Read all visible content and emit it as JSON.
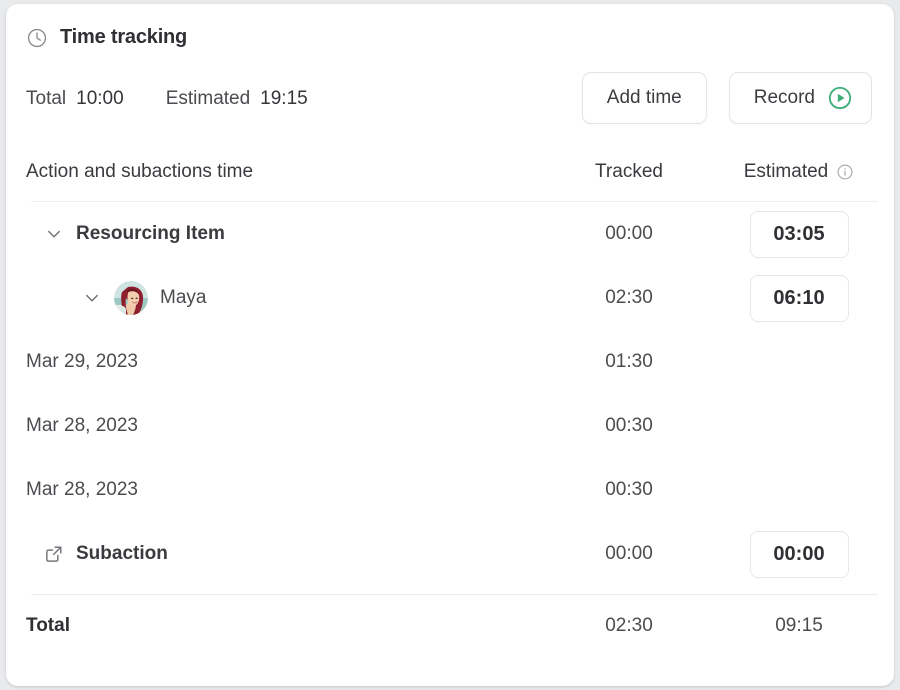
{
  "panel": {
    "title": "Time tracking",
    "icon": "clock-icon"
  },
  "summary": {
    "total_label": "Total",
    "total_value": "10:00",
    "estimated_label": "Estimated",
    "estimated_value": "19:15"
  },
  "actions": {
    "add_time_label": "Add time",
    "record_label": "Record",
    "record_icon": "circle-play-icon",
    "record_icon_color": "#3fae7a"
  },
  "columns": {
    "action": "Action and subactions time",
    "tracked": "Tracked",
    "estimated": "Estimated",
    "estimated_info_icon": "info-icon"
  },
  "rows": [
    {
      "label": "Resourcing Item",
      "icon": "chevron-down-icon",
      "tracked": "00:00",
      "estimated": "03:05",
      "estimated_boxed": true,
      "level": 1,
      "bold": true
    },
    {
      "label": "Maya",
      "icon": "chevron-down-icon",
      "avatar": "user-avatar",
      "tracked": "02:30",
      "estimated": "06:10",
      "estimated_boxed": true,
      "level": 2,
      "bold": false
    },
    {
      "label": "Mar 29, 2023",
      "tracked": "01:30",
      "estimated": "",
      "estimated_boxed": false,
      "level": 3,
      "bold": false
    },
    {
      "label": "Mar 28, 2023",
      "tracked": "00:30",
      "estimated": "",
      "estimated_boxed": false,
      "level": 3,
      "bold": false
    },
    {
      "label": "Mar 28, 2023",
      "tracked": "00:30",
      "estimated": "",
      "estimated_boxed": false,
      "level": 3,
      "bold": false
    },
    {
      "label": "Subaction",
      "icon": "external-link-icon",
      "tracked": "00:00",
      "estimated": "00:00",
      "estimated_boxed": true,
      "level": 1,
      "bold": true
    }
  ],
  "footer": {
    "label": "Total",
    "tracked": "02:30",
    "estimated": "09:15"
  },
  "colors": {
    "accent_green": "#3fae7a",
    "text_primary": "#2f3033",
    "text_secondary": "#4b4c50",
    "border": "#e6e7ea",
    "card_bg": "#ffffff",
    "page_bg": "#e9eaec"
  }
}
